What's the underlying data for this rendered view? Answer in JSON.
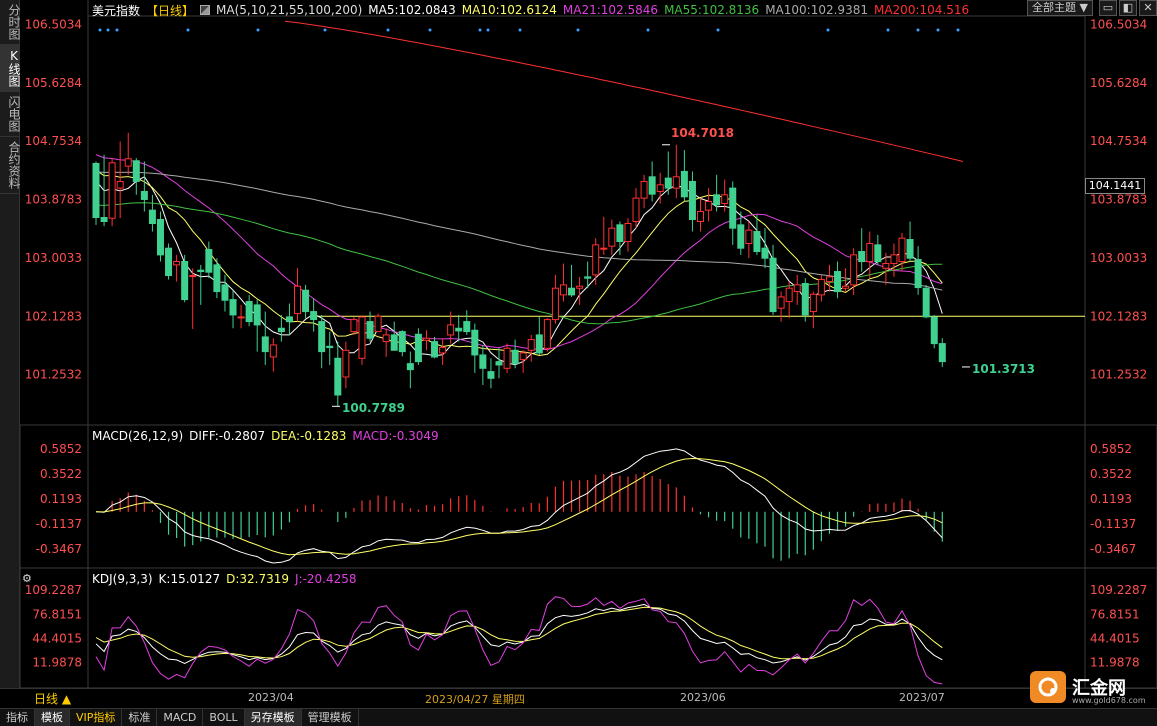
{
  "left_tabs": [
    {
      "label": "分时图",
      "active": false
    },
    {
      "label": "K线图",
      "active": true
    },
    {
      "label": "闪电图",
      "active": false
    },
    {
      "label": "合约资料",
      "active": false
    }
  ],
  "header": {
    "instrument": "美元指数",
    "period_tag": "【日线】",
    "ma_params": "MA(5,10,21,55,100,200)",
    "ma_values": [
      {
        "label": "MA5:102.0843",
        "color": "#ffffff"
      },
      {
        "label": "MA10:102.6124",
        "color": "#ffff66"
      },
      {
        "label": "MA21:102.5846",
        "color": "#e040e0"
      },
      {
        "label": "MA55:102.8136",
        "color": "#40c040"
      },
      {
        "label": "MA100:102.9381",
        "color": "#aaaaaa"
      },
      {
        "label": "MA200:104.516",
        "color": "#ff3030"
      }
    ],
    "theme_select": "全部主题",
    "window_buttons": [
      "▭",
      "◧",
      "✕"
    ]
  },
  "price_axis": {
    "ticks": [
      "106.5034",
      "105.6284",
      "104.7534",
      "103.8783",
      "103.0033",
      "102.1283",
      "101.2532"
    ],
    "last_price": "104.1441"
  },
  "annotations": {
    "high": "104.7018",
    "low": "100.7789",
    "last_low": "101.3713"
  },
  "macd": {
    "label": "MACD(26,12,9)",
    "diff": "DIFF:-0.2807",
    "dea": "DEA:-0.1283",
    "macd": "MACD:-0.3049",
    "ticks": [
      "0.5852",
      "0.3522",
      "0.1193",
      "-0.1137",
      "-0.3467"
    ]
  },
  "kdj": {
    "label": "KDJ(9,3,3)",
    "k": "K:15.0127",
    "d": "D:32.7319",
    "j": "J:-20.4258",
    "ticks": [
      "109.2287",
      "76.8151",
      "44.4015",
      "11.9878"
    ]
  },
  "xaxis": {
    "period": "日线 ▲",
    "labels": [
      {
        "text": "2023/04",
        "highlight": false
      },
      {
        "text": "2023/04/27 星期四",
        "highlight": true
      },
      {
        "text": "2023/06",
        "highlight": false
      },
      {
        "text": "2023/07",
        "highlight": false
      }
    ]
  },
  "bottom_tabs": [
    {
      "label": "指标",
      "active": false,
      "vip": false
    },
    {
      "label": "模板",
      "active": true,
      "vip": false
    },
    {
      "label": "VIP指标",
      "active": false,
      "vip": true
    },
    {
      "label": "标准",
      "active": false,
      "vip": false
    },
    {
      "label": "MACD",
      "active": false,
      "vip": false
    },
    {
      "label": "BOLL",
      "active": false,
      "vip": false
    },
    {
      "label": "另存模板",
      "active": true,
      "vip": false
    },
    {
      "label": "管理模板",
      "active": false,
      "vip": false
    }
  ],
  "logo": {
    "name": "汇金网",
    "url": "www.gold678.com"
  },
  "colors": {
    "up": "#ff3030",
    "down": "#40d090",
    "ma5": "#ffffff",
    "ma10": "#ffff66",
    "ma21": "#e040e0",
    "ma55": "#40c040",
    "ma100": "#aaaaaa",
    "ma200": "#ff3030",
    "hline": "#ffff66"
  },
  "chart_data": {
    "type": "candlestick",
    "title": "美元指数 日线",
    "ylim": [
      100.5,
      106.6
    ],
    "hline": 102.13,
    "candles": [
      [
        104.42,
        104.45,
        103.5,
        103.61
      ],
      [
        103.61,
        104.55,
        103.48,
        103.55
      ],
      [
        103.6,
        104.5,
        103.48,
        104.43
      ],
      [
        104.05,
        104.75,
        103.6,
        104.15
      ],
      [
        104.38,
        104.88,
        104.25,
        104.49
      ],
      [
        104.46,
        104.5,
        103.95,
        104.15
      ],
      [
        104.0,
        104.45,
        103.7,
        103.88
      ],
      [
        103.72,
        103.95,
        103.4,
        103.52
      ],
      [
        103.58,
        103.7,
        102.95,
        103.05
      ],
      [
        103.15,
        103.22,
        102.68,
        102.74
      ],
      [
        102.9,
        103.05,
        102.65,
        102.95
      ],
      [
        102.95,
        103.05,
        102.34,
        102.38
      ],
      [
        102.74,
        102.85,
        101.94,
        102.74
      ],
      [
        102.82,
        102.9,
        102.3,
        102.8
      ],
      [
        103.13,
        103.25,
        102.7,
        102.79
      ],
      [
        102.9,
        103.0,
        102.4,
        102.5
      ],
      [
        102.6,
        102.75,
        102.2,
        102.37
      ],
      [
        102.38,
        102.52,
        101.95,
        102.15
      ],
      [
        102.12,
        102.3,
        101.95,
        102.12
      ],
      [
        102.35,
        102.45,
        101.98,
        102.05
      ],
      [
        102.3,
        102.38,
        101.6,
        102.0
      ],
      [
        101.82,
        102.2,
        101.4,
        101.6
      ],
      [
        101.52,
        101.8,
        101.3,
        101.7
      ],
      [
        101.95,
        102.15,
        101.75,
        101.9
      ],
      [
        102.12,
        102.32,
        101.85,
        102.05
      ],
      [
        102.17,
        102.85,
        102.05,
        102.58
      ],
      [
        102.52,
        102.6,
        102.1,
        102.2
      ],
      [
        102.2,
        102.4,
        101.9,
        102.08
      ],
      [
        102.05,
        102.15,
        101.35,
        101.6
      ],
      [
        101.68,
        101.9,
        101.4,
        101.66
      ],
      [
        101.5,
        101.75,
        100.78,
        100.95
      ],
      [
        101.22,
        101.75,
        101.05,
        101.62
      ],
      [
        101.9,
        102.12,
        101.85,
        102.08
      ],
      [
        101.5,
        102.12,
        101.4,
        102.12
      ],
      [
        102.05,
        102.2,
        101.75,
        101.8
      ],
      [
        101.9,
        102.17,
        101.9,
        102.13
      ],
      [
        101.75,
        101.95,
        101.52,
        101.85
      ],
      [
        101.85,
        102.05,
        101.62,
        101.62
      ],
      [
        101.9,
        101.92,
        101.53,
        101.6
      ],
      [
        101.42,
        101.6,
        101.05,
        101.33
      ],
      [
        101.86,
        101.95,
        101.4,
        101.45
      ],
      [
        101.77,
        101.92,
        101.62,
        101.8
      ],
      [
        101.75,
        101.82,
        101.5,
        101.52
      ],
      [
        101.58,
        101.8,
        101.4,
        101.66
      ],
      [
        101.85,
        102.2,
        101.72,
        102.0
      ],
      [
        101.95,
        102.15,
        101.75,
        101.91
      ],
      [
        102.05,
        102.22,
        101.85,
        101.9
      ],
      [
        101.92,
        102.02,
        101.28,
        101.55
      ],
      [
        101.55,
        101.7,
        101.1,
        101.35
      ],
      [
        101.3,
        101.5,
        101.05,
        101.2
      ],
      [
        101.45,
        101.65,
        101.2,
        101.4
      ],
      [
        101.35,
        101.72,
        101.28,
        101.65
      ],
      [
        101.62,
        101.78,
        101.35,
        101.42
      ],
      [
        101.48,
        101.62,
        101.28,
        101.58
      ],
      [
        101.62,
        101.85,
        101.45,
        101.78
      ],
      [
        101.85,
        102.12,
        101.55,
        101.58
      ],
      [
        101.65,
        102.1,
        101.6,
        102.08
      ],
      [
        102.08,
        102.75,
        102.02,
        102.55
      ],
      [
        102.45,
        102.92,
        102.35,
        102.6
      ],
      [
        102.55,
        102.9,
        102.42,
        102.45
      ],
      [
        102.55,
        102.72,
        102.3,
        102.58
      ],
      [
        102.72,
        102.95,
        102.55,
        102.7
      ],
      [
        102.75,
        103.3,
        102.6,
        103.2
      ],
      [
        103.15,
        103.62,
        103.05,
        103.15
      ],
      [
        103.18,
        103.58,
        103.05,
        103.45
      ],
      [
        103.5,
        103.55,
        103.05,
        103.25
      ],
      [
        103.25,
        103.6,
        103.1,
        103.52
      ],
      [
        103.55,
        104.05,
        103.45,
        103.9
      ],
      [
        103.9,
        104.25,
        103.75,
        104.15
      ],
      [
        104.22,
        104.45,
        103.85,
        103.96
      ],
      [
        104.0,
        104.28,
        103.82,
        104.1
      ],
      [
        104.2,
        104.6,
        103.95,
        104.05
      ],
      [
        104.05,
        104.7,
        103.9,
        104.22
      ],
      [
        104.3,
        104.62,
        103.85,
        103.92
      ],
      [
        104.15,
        104.3,
        103.4,
        103.58
      ],
      [
        103.55,
        103.9,
        103.4,
        103.7
      ],
      [
        103.72,
        104.05,
        103.55,
        103.85
      ],
      [
        103.95,
        104.25,
        103.7,
        103.8
      ],
      [
        103.82,
        104.18,
        103.7,
        103.95
      ],
      [
        104.05,
        104.15,
        103.2,
        103.45
      ],
      [
        103.5,
        103.7,
        103.05,
        103.15
      ],
      [
        103.22,
        103.55,
        103.0,
        103.42
      ],
      [
        103.4,
        103.65,
        103.05,
        103.1
      ],
      [
        103.15,
        103.45,
        102.85,
        103.0
      ],
      [
        103.0,
        103.2,
        102.15,
        102.2
      ],
      [
        102.25,
        102.5,
        102.05,
        102.42
      ],
      [
        102.35,
        102.65,
        102.1,
        102.55
      ],
      [
        102.5,
        102.75,
        102.3,
        102.6
      ],
      [
        102.62,
        102.7,
        102.05,
        102.15
      ],
      [
        102.2,
        102.5,
        101.95,
        102.46
      ],
      [
        102.45,
        102.75,
        102.35,
        102.68
      ],
      [
        102.65,
        102.9,
        102.5,
        102.72
      ],
      [
        102.8,
        102.95,
        102.4,
        102.5
      ],
      [
        102.55,
        102.85,
        102.5,
        102.58
      ],
      [
        102.6,
        103.15,
        102.45,
        103.05
      ],
      [
        103.1,
        103.45,
        102.8,
        102.95
      ],
      [
        102.95,
        103.4,
        102.7,
        103.22
      ],
      [
        103.2,
        103.35,
        102.9,
        102.95
      ],
      [
        102.85,
        103.08,
        102.6,
        102.92
      ],
      [
        102.92,
        103.22,
        102.72,
        103.05
      ],
      [
        102.95,
        103.38,
        102.8,
        103.3
      ],
      [
        103.28,
        103.55,
        102.95,
        103.0
      ],
      [
        102.98,
        103.18,
        102.45,
        102.56
      ],
      [
        102.55,
        102.6,
        102.1,
        102.12
      ],
      [
        102.12,
        102.15,
        101.65,
        101.72
      ],
      [
        101.72,
        101.8,
        101.37,
        101.45
      ]
    ]
  }
}
